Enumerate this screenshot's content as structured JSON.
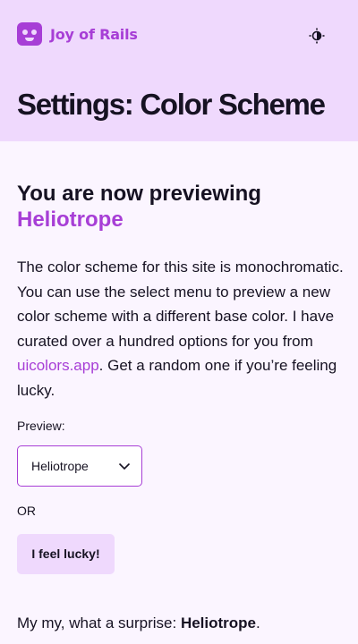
{
  "brand": {
    "name": "Joy of Rails"
  },
  "header": {
    "title": "Settings: Color Scheme",
    "toggle_icon": "contrast-icon"
  },
  "preview": {
    "heading_prefix": "You are now previewing",
    "scheme_name": "Heliotrope"
  },
  "intro": {
    "text_before": "The color scheme for this site is monochromatic. You can use the select menu to preview a new color scheme with a different base color. I have curated over a hundred options for you from ",
    "link": "uicolors.app",
    "text_after": ". Get a random one if you’re feeling lucky."
  },
  "form": {
    "preview_label": "Preview:",
    "selected": "Heliotrope",
    "or_label": "OR",
    "lucky_button": "I feel lucky!"
  },
  "result": {
    "prefix": "My my, what a surprise: ",
    "name": "Heliotrope",
    "suffix": "."
  },
  "colors": {
    "accent": "#a73ed6",
    "header_bg": "#efd9fd",
    "page_bg": "#fbf5ff",
    "text": "#161222"
  }
}
